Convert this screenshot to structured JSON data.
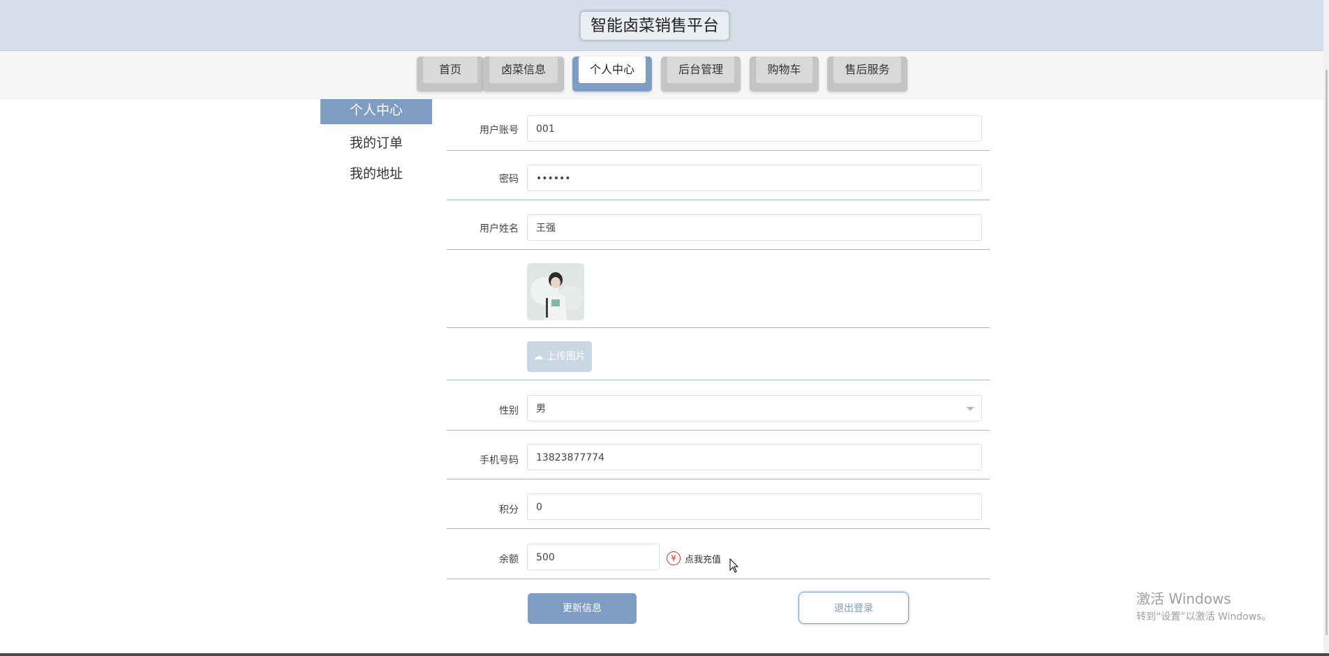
{
  "header": {
    "title": "智能卤菜销售平台"
  },
  "nav": {
    "tabs": [
      {
        "label": "首页"
      },
      {
        "label": "卤菜信息"
      },
      {
        "label": "个人中心",
        "active": true
      },
      {
        "label": "后台管理"
      },
      {
        "label": "购物车"
      },
      {
        "label": "售后服务"
      }
    ]
  },
  "sidebar": {
    "items": [
      {
        "label": "个人中心",
        "active": true
      },
      {
        "label": "我的订单"
      },
      {
        "label": "我的地址"
      }
    ]
  },
  "form": {
    "account_label": "用户账号",
    "account_value": "001",
    "password_label": "密码",
    "password_value": "••••••",
    "name_label": "用户姓名",
    "name_value": "王强",
    "upload_label": "上传图片",
    "gender_label": "性别",
    "gender_value": "男",
    "phone_label": "手机号码",
    "phone_value": "13823877774",
    "points_label": "积分",
    "points_value": "0",
    "balance_label": "余额",
    "balance_value": "500",
    "recharge_symbol": "¥",
    "recharge_label": "点我充值"
  },
  "buttons": {
    "update_label": "更新信息",
    "logout_label": "退出登录"
  },
  "watermark": {
    "line1": "激活 Windows",
    "line2": "转到“设置”以激活 Windows。"
  },
  "colors": {
    "accent": "#7f9dc2",
    "header_bg": "#d6dfe9",
    "recharge_red": "#e2332d"
  }
}
